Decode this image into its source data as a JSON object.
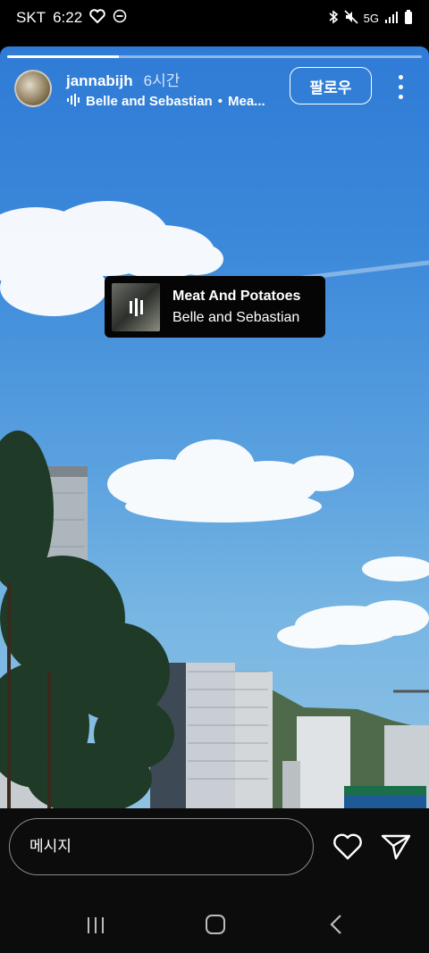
{
  "status_bar": {
    "carrier": "SKT",
    "time": "6:22",
    "network": "5G"
  },
  "story": {
    "progress": 0.27,
    "user": {
      "username": "jannabijh",
      "time_ago": "6시간"
    },
    "music": {
      "artist": "Belle and Sebastian",
      "separator": "•",
      "track_truncated": "Mea..."
    },
    "follow_label": "팔로우",
    "sticker": {
      "title": "Meat And Potatoes",
      "artist": "Belle and Sebastian"
    }
  },
  "composer": {
    "placeholder": "메시지"
  },
  "icons": {
    "like": "heart-icon",
    "share": "send-icon",
    "more": "more-vertical-icon",
    "nav": [
      "recents-icon",
      "home-icon",
      "back-icon"
    ]
  }
}
